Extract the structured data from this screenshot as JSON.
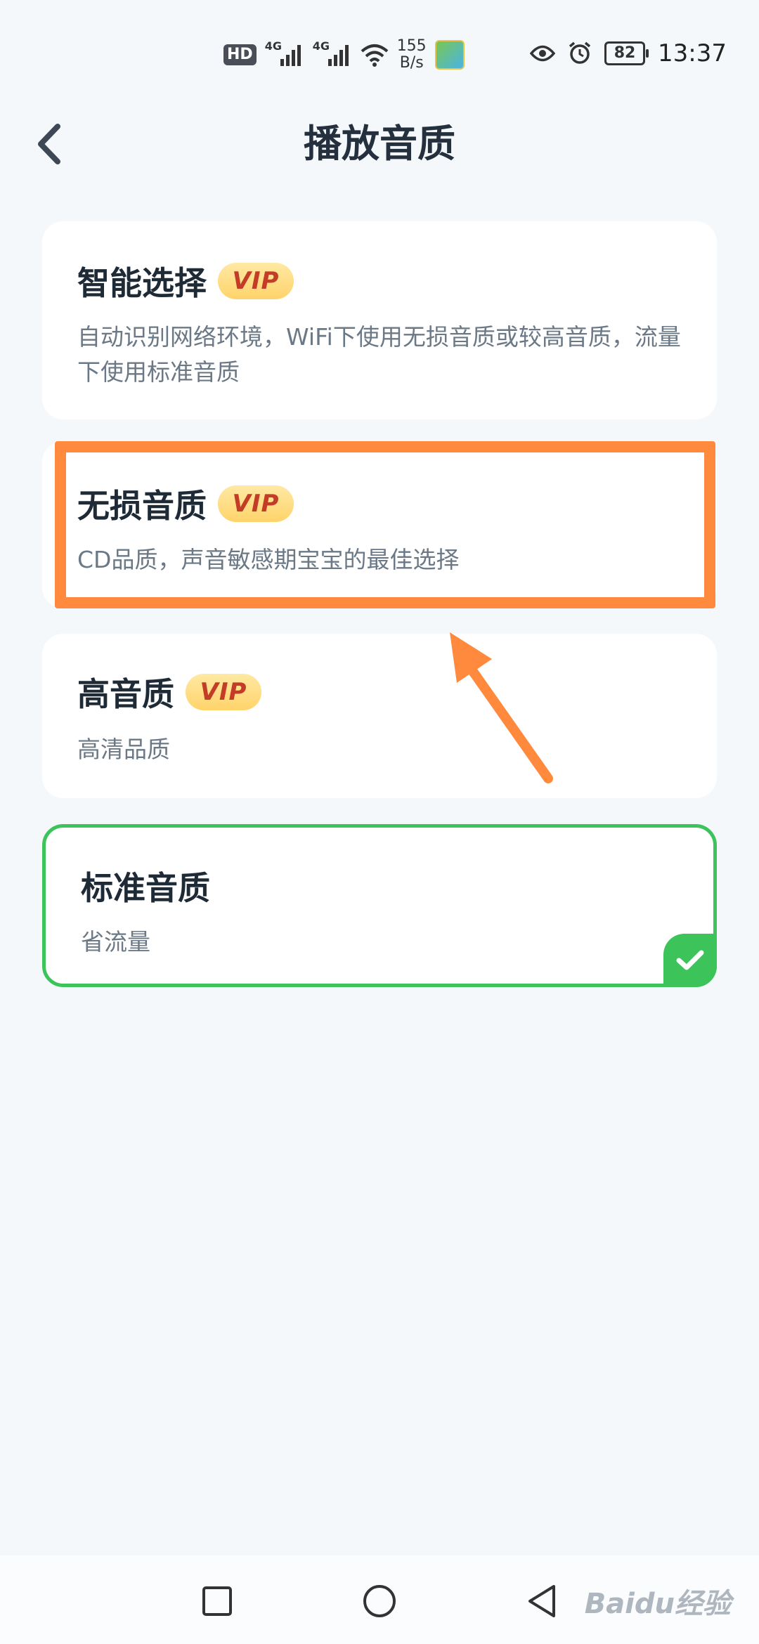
{
  "status_bar": {
    "hd": "HD",
    "net1": "4G",
    "net2": "4G",
    "speed_value": "155",
    "speed_unit": "B/s",
    "battery": "82",
    "time": "13:37"
  },
  "header": {
    "title": "播放音质"
  },
  "options": [
    {
      "title": "智能选择",
      "vip": "VIP",
      "desc": "自动识别网络环境，WiFi下使用无损音质或较高音质，流量下使用标准音质"
    },
    {
      "title": "无损音质",
      "vip": "VIP",
      "desc": "CD品质，声音敏感期宝宝的最佳选择"
    },
    {
      "title": "高音质",
      "vip": "VIP",
      "desc": "高清品质"
    },
    {
      "title": "标准音质",
      "desc": "省流量"
    }
  ],
  "watermark": "Baidu经验",
  "colors": {
    "background": "#f4f8fb",
    "selected_green": "#3cc35a",
    "highlight_orange": "#ff8a3d",
    "vip_text": "#c23c27"
  }
}
